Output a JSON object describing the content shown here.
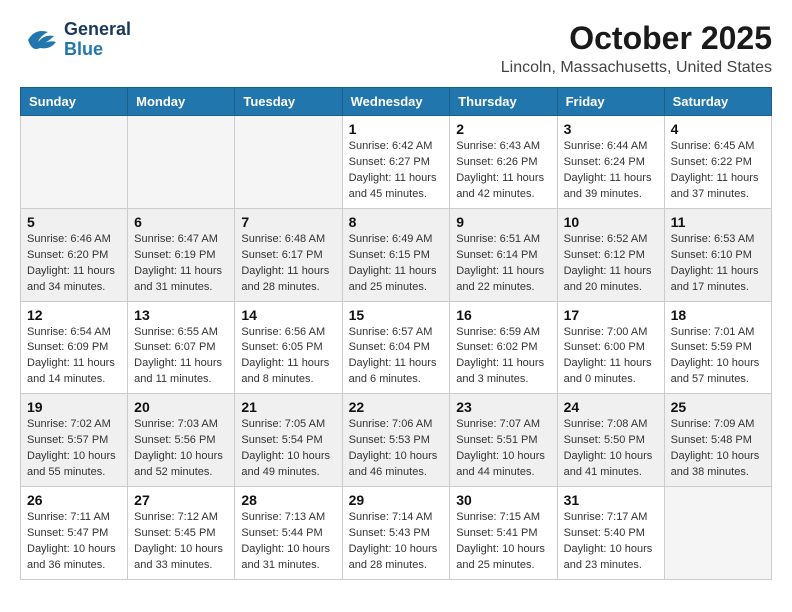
{
  "logo": {
    "general": "General",
    "blue": "Blue"
  },
  "title": {
    "month": "October 2025",
    "location": "Lincoln, Massachusetts, United States"
  },
  "days_of_week": [
    "Sunday",
    "Monday",
    "Tuesday",
    "Wednesday",
    "Thursday",
    "Friday",
    "Saturday"
  ],
  "weeks": [
    [
      {
        "day": "",
        "sunrise": "",
        "sunset": "",
        "daylight": ""
      },
      {
        "day": "",
        "sunrise": "",
        "sunset": "",
        "daylight": ""
      },
      {
        "day": "",
        "sunrise": "",
        "sunset": "",
        "daylight": ""
      },
      {
        "day": "1",
        "sunrise": "Sunrise: 6:42 AM",
        "sunset": "Sunset: 6:27 PM",
        "daylight": "Daylight: 11 hours and 45 minutes."
      },
      {
        "day": "2",
        "sunrise": "Sunrise: 6:43 AM",
        "sunset": "Sunset: 6:26 PM",
        "daylight": "Daylight: 11 hours and 42 minutes."
      },
      {
        "day": "3",
        "sunrise": "Sunrise: 6:44 AM",
        "sunset": "Sunset: 6:24 PM",
        "daylight": "Daylight: 11 hours and 39 minutes."
      },
      {
        "day": "4",
        "sunrise": "Sunrise: 6:45 AM",
        "sunset": "Sunset: 6:22 PM",
        "daylight": "Daylight: 11 hours and 37 minutes."
      }
    ],
    [
      {
        "day": "5",
        "sunrise": "Sunrise: 6:46 AM",
        "sunset": "Sunset: 6:20 PM",
        "daylight": "Daylight: 11 hours and 34 minutes."
      },
      {
        "day": "6",
        "sunrise": "Sunrise: 6:47 AM",
        "sunset": "Sunset: 6:19 PM",
        "daylight": "Daylight: 11 hours and 31 minutes."
      },
      {
        "day": "7",
        "sunrise": "Sunrise: 6:48 AM",
        "sunset": "Sunset: 6:17 PM",
        "daylight": "Daylight: 11 hours and 28 minutes."
      },
      {
        "day": "8",
        "sunrise": "Sunrise: 6:49 AM",
        "sunset": "Sunset: 6:15 PM",
        "daylight": "Daylight: 11 hours and 25 minutes."
      },
      {
        "day": "9",
        "sunrise": "Sunrise: 6:51 AM",
        "sunset": "Sunset: 6:14 PM",
        "daylight": "Daylight: 11 hours and 22 minutes."
      },
      {
        "day": "10",
        "sunrise": "Sunrise: 6:52 AM",
        "sunset": "Sunset: 6:12 PM",
        "daylight": "Daylight: 11 hours and 20 minutes."
      },
      {
        "day": "11",
        "sunrise": "Sunrise: 6:53 AM",
        "sunset": "Sunset: 6:10 PM",
        "daylight": "Daylight: 11 hours and 17 minutes."
      }
    ],
    [
      {
        "day": "12",
        "sunrise": "Sunrise: 6:54 AM",
        "sunset": "Sunset: 6:09 PM",
        "daylight": "Daylight: 11 hours and 14 minutes."
      },
      {
        "day": "13",
        "sunrise": "Sunrise: 6:55 AM",
        "sunset": "Sunset: 6:07 PM",
        "daylight": "Daylight: 11 hours and 11 minutes."
      },
      {
        "day": "14",
        "sunrise": "Sunrise: 6:56 AM",
        "sunset": "Sunset: 6:05 PM",
        "daylight": "Daylight: 11 hours and 8 minutes."
      },
      {
        "day": "15",
        "sunrise": "Sunrise: 6:57 AM",
        "sunset": "Sunset: 6:04 PM",
        "daylight": "Daylight: 11 hours and 6 minutes."
      },
      {
        "day": "16",
        "sunrise": "Sunrise: 6:59 AM",
        "sunset": "Sunset: 6:02 PM",
        "daylight": "Daylight: 11 hours and 3 minutes."
      },
      {
        "day": "17",
        "sunrise": "Sunrise: 7:00 AM",
        "sunset": "Sunset: 6:00 PM",
        "daylight": "Daylight: 11 hours and 0 minutes."
      },
      {
        "day": "18",
        "sunrise": "Sunrise: 7:01 AM",
        "sunset": "Sunset: 5:59 PM",
        "daylight": "Daylight: 10 hours and 57 minutes."
      }
    ],
    [
      {
        "day": "19",
        "sunrise": "Sunrise: 7:02 AM",
        "sunset": "Sunset: 5:57 PM",
        "daylight": "Daylight: 10 hours and 55 minutes."
      },
      {
        "day": "20",
        "sunrise": "Sunrise: 7:03 AM",
        "sunset": "Sunset: 5:56 PM",
        "daylight": "Daylight: 10 hours and 52 minutes."
      },
      {
        "day": "21",
        "sunrise": "Sunrise: 7:05 AM",
        "sunset": "Sunset: 5:54 PM",
        "daylight": "Daylight: 10 hours and 49 minutes."
      },
      {
        "day": "22",
        "sunrise": "Sunrise: 7:06 AM",
        "sunset": "Sunset: 5:53 PM",
        "daylight": "Daylight: 10 hours and 46 minutes."
      },
      {
        "day": "23",
        "sunrise": "Sunrise: 7:07 AM",
        "sunset": "Sunset: 5:51 PM",
        "daylight": "Daylight: 10 hours and 44 minutes."
      },
      {
        "day": "24",
        "sunrise": "Sunrise: 7:08 AM",
        "sunset": "Sunset: 5:50 PM",
        "daylight": "Daylight: 10 hours and 41 minutes."
      },
      {
        "day": "25",
        "sunrise": "Sunrise: 7:09 AM",
        "sunset": "Sunset: 5:48 PM",
        "daylight": "Daylight: 10 hours and 38 minutes."
      }
    ],
    [
      {
        "day": "26",
        "sunrise": "Sunrise: 7:11 AM",
        "sunset": "Sunset: 5:47 PM",
        "daylight": "Daylight: 10 hours and 36 minutes."
      },
      {
        "day": "27",
        "sunrise": "Sunrise: 7:12 AM",
        "sunset": "Sunset: 5:45 PM",
        "daylight": "Daylight: 10 hours and 33 minutes."
      },
      {
        "day": "28",
        "sunrise": "Sunrise: 7:13 AM",
        "sunset": "Sunset: 5:44 PM",
        "daylight": "Daylight: 10 hours and 31 minutes."
      },
      {
        "day": "29",
        "sunrise": "Sunrise: 7:14 AM",
        "sunset": "Sunset: 5:43 PM",
        "daylight": "Daylight: 10 hours and 28 minutes."
      },
      {
        "day": "30",
        "sunrise": "Sunrise: 7:15 AM",
        "sunset": "Sunset: 5:41 PM",
        "daylight": "Daylight: 10 hours and 25 minutes."
      },
      {
        "day": "31",
        "sunrise": "Sunrise: 7:17 AM",
        "sunset": "Sunset: 5:40 PM",
        "daylight": "Daylight: 10 hours and 23 minutes."
      },
      {
        "day": "",
        "sunrise": "",
        "sunset": "",
        "daylight": ""
      }
    ]
  ]
}
